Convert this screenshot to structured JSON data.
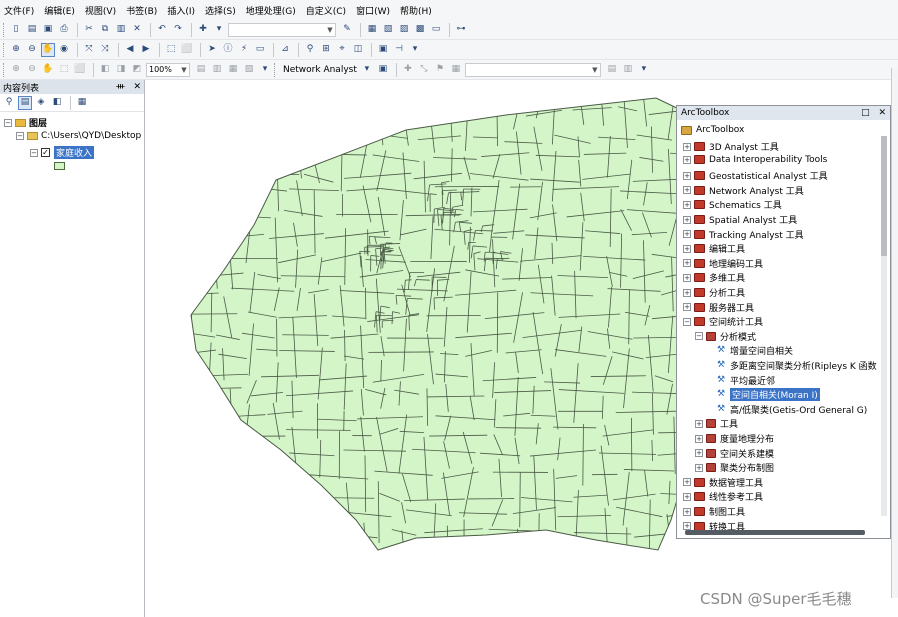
{
  "menu": [
    "文件(F)",
    "编辑(E)",
    "视图(V)",
    "书签(B)",
    "插入(I)",
    "选择(S)",
    "地理处理(G)",
    "自定义(C)",
    "窗口(W)",
    "帮助(H)"
  ],
  "toolbar": {
    "scale_value": "",
    "zoom_value": "100%",
    "network_analyst_label": "Network Analyst"
  },
  "toc": {
    "title": "内容列表",
    "pin": "ᚒ",
    "close": "✕",
    "root_label": "图层",
    "folder_label": "C:\\Users\\QYD\\Desktop",
    "layer_label": "家庭收入"
  },
  "arctoolbox": {
    "title": "ArcToolbox",
    "pin": "□",
    "close": "✕",
    "root_label": "ArcToolbox",
    "items": [
      "3D Analyst 工具",
      "Data Interoperability Tools",
      "Geostatistical Analyst 工具",
      "Network Analyst 工具",
      "Schematics 工具",
      "Spatial Analyst 工具",
      "Tracking Analyst 工具",
      "编辑工具",
      "地理编码工具",
      "多维工具",
      "分析工具",
      "服务器工具",
      "空间统计工具"
    ],
    "subgroup_label": "分析模式",
    "tools": [
      "增量空间自相关",
      "多距离空间聚类分析(Ripleys K 函数",
      "平均最近邻",
      "空间自相关(Moran I)",
      "高/低聚类(Getis-Ord General G)"
    ],
    "subgroups_after": [
      "工具",
      "度量地理分布",
      "空间关系建模",
      "聚类分布制图"
    ],
    "items_after": [
      "数据管理工具",
      "线性参考工具",
      "制图工具",
      "转换工具"
    ]
  },
  "watermark": "CSDN @Super毛毛穗",
  "colors": {
    "polygon_fill": "#d3f5c8",
    "polygon_stroke": "#4a5a46",
    "selection": "#3b73c7",
    "toolbox_red": "#c0392b"
  }
}
